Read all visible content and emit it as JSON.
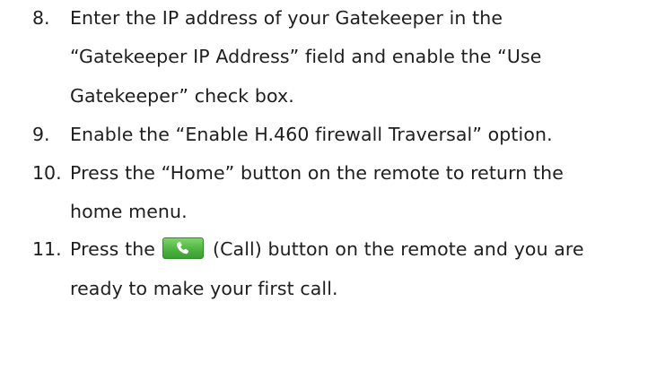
{
  "steps": [
    {
      "number": "8.",
      "lines": [
        "Enter the IP address of your Gatekeeper in the",
        "“Gatekeeper IP Address” field and enable the “Use",
        "Gatekeeper” check box."
      ]
    },
    {
      "number": "9.",
      "lines": [
        "Enable the “Enable H.460 firewall Traversal” option."
      ]
    },
    {
      "number": "10.",
      "lines": [
        "Press the “Home” button on the remote to return the",
        "home menu."
      ]
    },
    {
      "number": "11.",
      "line1_before_icon": "Press the",
      "line1_after_icon": "(Call) button on the remote and you are",
      "line2": "ready to make your first call.",
      "icon": "call-phone-icon",
      "icon_color": "#4fb443"
    }
  ]
}
